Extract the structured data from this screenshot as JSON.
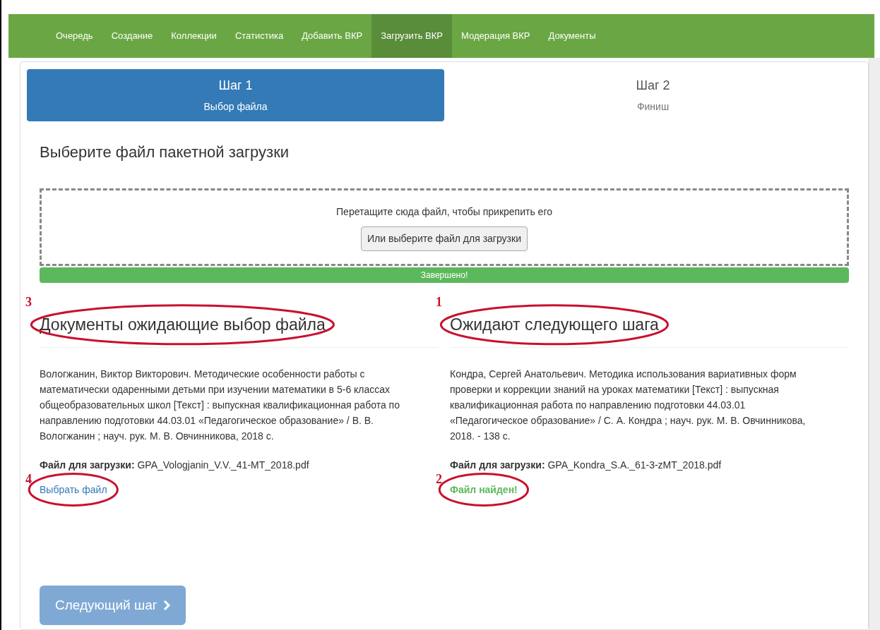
{
  "nav": [
    {
      "label": "Очередь",
      "selected": false
    },
    {
      "label": "Создание",
      "selected": false
    },
    {
      "label": "Коллекции",
      "selected": false
    },
    {
      "label": "Статистика",
      "selected": false
    },
    {
      "label": "Добавить ВКР",
      "selected": false
    },
    {
      "label": "Загрузить ВКР",
      "selected": true
    },
    {
      "label": "Модерация ВКР",
      "selected": false
    },
    {
      "label": "Документы",
      "selected": false
    }
  ],
  "steps": [
    {
      "title": "Шаг 1",
      "subtitle": "Выбор файла",
      "selected": true
    },
    {
      "title": "Шаг 2",
      "subtitle": "Финиш",
      "selected": false
    }
  ],
  "page_heading": "Выберите файл пакетной загрузки",
  "dropzone": {
    "hint": "Перетащите сюда файл, чтобы прикрепить его",
    "button": "Или выберите файл для загрузки"
  },
  "progress": {
    "level": 1,
    "label": "Завершено!"
  },
  "columns": [
    {
      "marker": "3",
      "heading": "Документы ожидающие выбор файла",
      "description": "Вологжанин, Виктор Викторович. Методические особенности работы с математически одаренными детьми при изучении математики в 5-6 классах общеобразовательных школ [Текст] : выпускная квалификационная работа по направлению подготовки 44.03.01 «Педагогическое образование» / В. В. Вологжанин ; науч. рук. М. В. Овчинникова, 2018 с.",
      "file_line": "**Файл для загрузки:** GPA_Vologjanin_V.V._41-MT_2018.pdf",
      "action": {
        "kind": "link",
        "text": "Выбрать файл",
        "marker": "4"
      }
    },
    {
      "marker": "1",
      "heading": "Ожидают следующего шага",
      "description": "Кондра, Сергей Анатольевич. Методика использования вариативных форм проверки и коррекции знаний на уроках математики [Текст] : выпускная квалификационная работа по направлению подготовки 44.03.01 «Педагогическое образование» / С. А. Кондра ; науч. рук. М. В. Овчинникова, 2018. - 138 с.",
      "file_line": "**Файл для загрузки:** GPA_Kondra_S.A._61-3-zMT_2018.pdf",
      "action": {
        "kind": "status",
        "text": "Файл найден!",
        "marker": "2"
      }
    }
  ],
  "next_button": {
    "label": "Следующий шаг",
    "disabled": true
  }
}
